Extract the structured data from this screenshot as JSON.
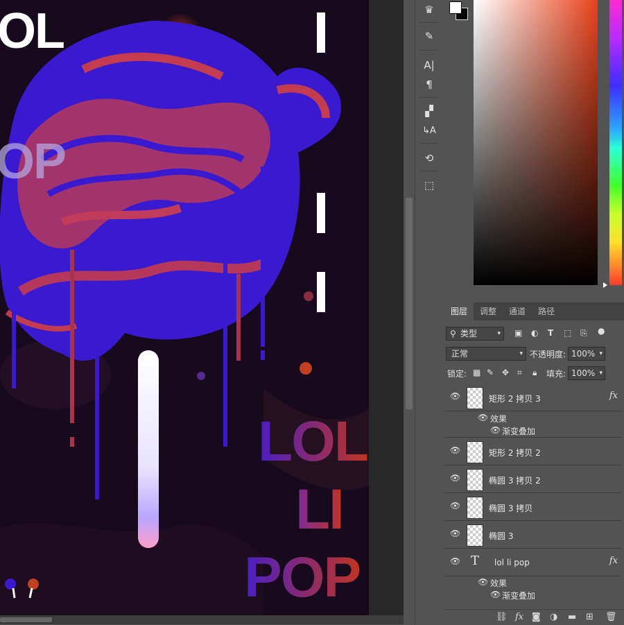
{
  "canvas": {
    "poster_top_left": [
      "OL",
      "I",
      "OP"
    ],
    "poster_right": [
      "LOL",
      "LI",
      "POP"
    ]
  },
  "toolbar": {
    "tools": [
      "crown-icon",
      "brush-settings-icon",
      "character-icon",
      "paragraph-icon",
      "character-style-icon",
      "paragraph-style-icon",
      "history-icon",
      "3d-icon"
    ]
  },
  "panel": {
    "tabs": [
      "图层",
      "调整",
      "通道",
      "路径"
    ],
    "filter": {
      "label": "类型"
    },
    "blend_mode": "正常",
    "opacity_label": "不透明度:",
    "opacity_value": "100%",
    "lock_label": "锁定:",
    "fill_label": "填充:",
    "fill_value": "100%",
    "layers": [
      {
        "name": "矩形 2 拷贝 3",
        "fx": "fx",
        "effects_label": "效果",
        "effect": "渐变叠加"
      },
      {
        "name": "矩形 2 拷贝 2"
      },
      {
        "name": "椭圆 3 拷贝 2"
      },
      {
        "name": "椭圆 3 拷贝"
      },
      {
        "name": "椭圆 3"
      },
      {
        "name": "lol li pop",
        "fx": "fx",
        "effects_label": "效果",
        "effect": "渐变叠加"
      }
    ]
  },
  "colors": {
    "foreground": "#ffffff",
    "background": "#000000",
    "picker_hue": "#e8421b"
  }
}
